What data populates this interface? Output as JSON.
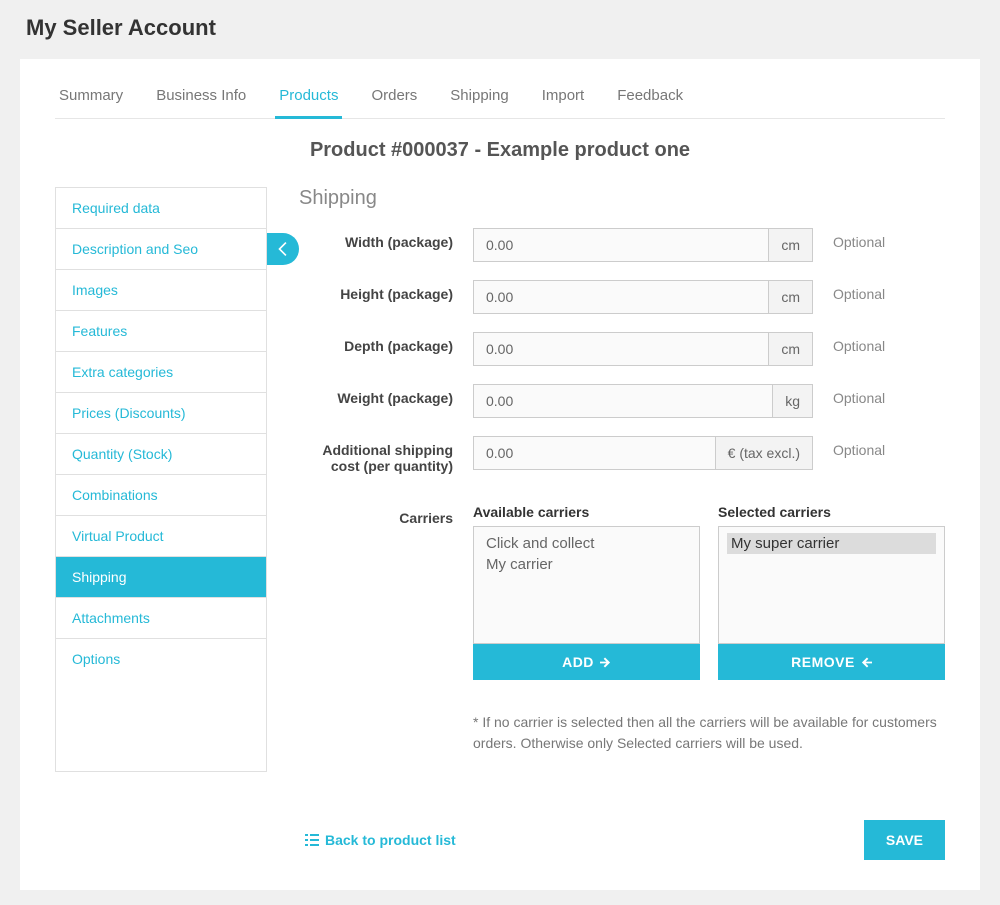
{
  "page_title": "My Seller Account",
  "tabs": [
    "Summary",
    "Business Info",
    "Products",
    "Orders",
    "Shipping",
    "Import",
    "Feedback"
  ],
  "active_tab": "Products",
  "product_header": "Product #000037 - Example product one",
  "sidebar": {
    "items": [
      {
        "label": "Required data"
      },
      {
        "label": "Description and Seo"
      },
      {
        "label": "Images"
      },
      {
        "label": "Features"
      },
      {
        "label": "Extra categories"
      },
      {
        "label": "Prices (Discounts)"
      },
      {
        "label": "Quantity (Stock)"
      },
      {
        "label": "Combinations"
      },
      {
        "label": "Virtual Product"
      },
      {
        "label": "Shipping"
      },
      {
        "label": "Attachments"
      },
      {
        "label": "Options"
      }
    ],
    "active": "Shipping"
  },
  "section_title": "Shipping",
  "fields": {
    "width": {
      "label": "Width (package)",
      "value": "0.00",
      "unit": "cm",
      "hint": "Optional"
    },
    "height": {
      "label": "Height (package)",
      "value": "0.00",
      "unit": "cm",
      "hint": "Optional"
    },
    "depth": {
      "label": "Depth (package)",
      "value": "0.00",
      "unit": "cm",
      "hint": "Optional"
    },
    "weight": {
      "label": "Weight (package)",
      "value": "0.00",
      "unit": "kg",
      "hint": "Optional"
    },
    "addcost": {
      "label": "Additional shipping cost (per quantity)",
      "value": "0.00",
      "unit": "€ (tax excl.)",
      "hint": "Optional"
    }
  },
  "carriers": {
    "label": "Carriers",
    "available_title": "Available carriers",
    "selected_title": "Selected carriers",
    "available": [
      "Click and collect",
      "My carrier"
    ],
    "selected": [
      "My super carrier"
    ],
    "add_label": "ADD",
    "remove_label": "REMOVE",
    "note": "* If no carrier is selected then all the carriers will be available for customers orders. Otherwise only Selected carriers will be used."
  },
  "footer": {
    "back_label": "Back to product list",
    "save_label": "SAVE"
  }
}
